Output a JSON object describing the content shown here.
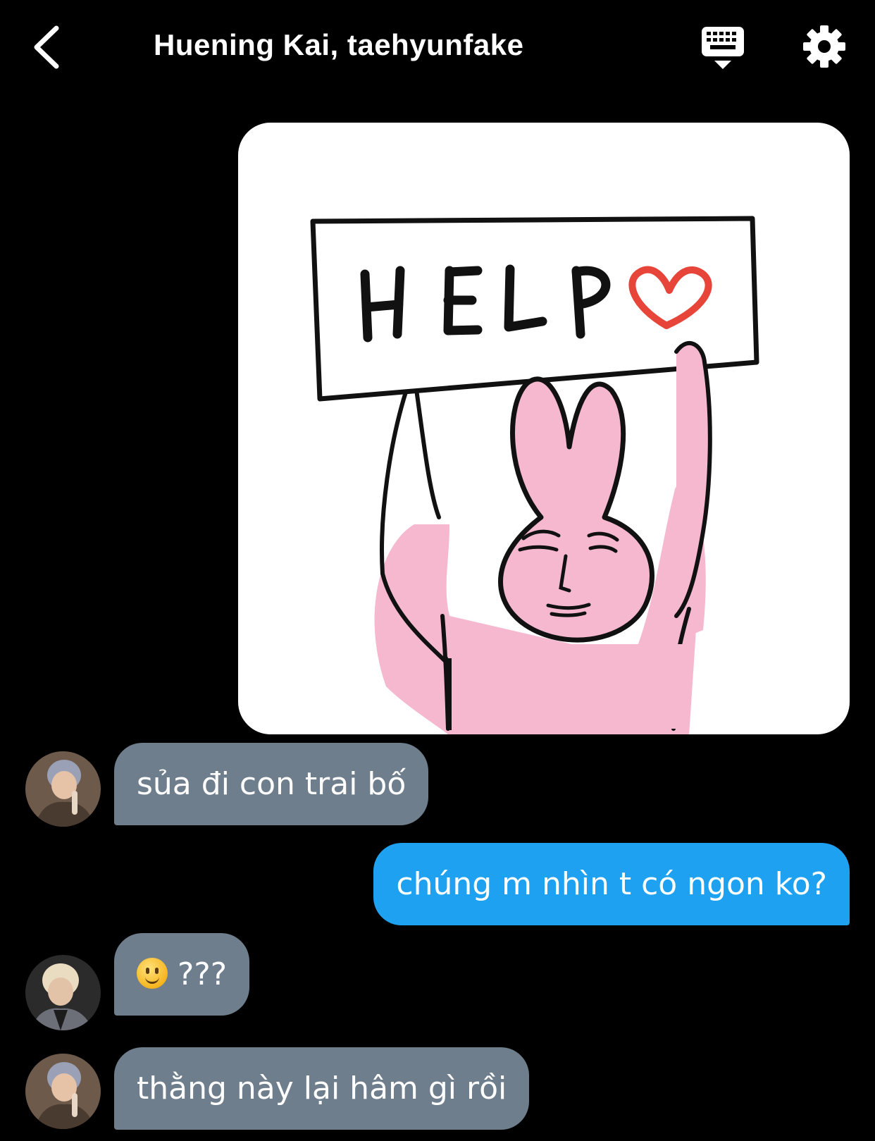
{
  "header": {
    "title": "Huening Kai, taehyunfake"
  },
  "sticker": {
    "sign_text": "HELP"
  },
  "messages": [
    {
      "sender": "incoming",
      "text": "sủa đi con trai bố"
    },
    {
      "sender": "outgoing",
      "text": "chúng m nhìn t có ngon ko?"
    },
    {
      "sender": "incoming",
      "text": "???"
    },
    {
      "sender": "incoming",
      "text": "thằng này lại hâm gì rồi"
    }
  ],
  "colors": {
    "background": "#000000",
    "incoming_bubble": "#6f7e8d",
    "outgoing_bubble": "#1fa1f1",
    "sticker_pink": "#f5b8cf",
    "heart_red": "#e8453a"
  }
}
